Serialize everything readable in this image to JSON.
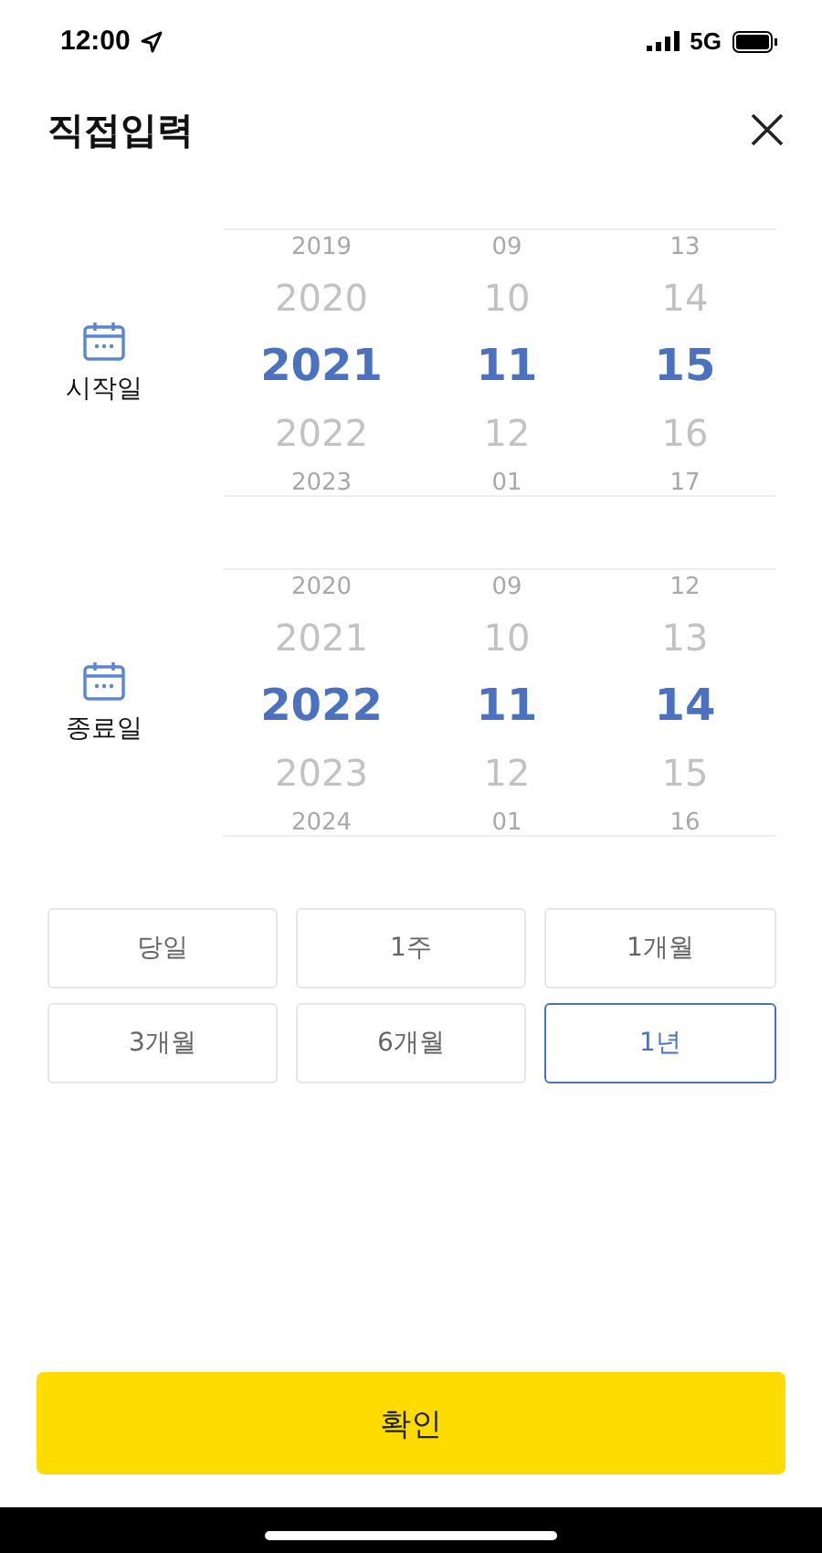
{
  "status_bar": {
    "time": "12:00",
    "network": "5G"
  },
  "header": {
    "title": "직접입력"
  },
  "pickers": [
    {
      "label": "시작일",
      "columns": [
        {
          "items": [
            {
              "text": "2019",
              "selected": false
            },
            {
              "text": "2020",
              "selected": false
            },
            {
              "text": "2021",
              "selected": true
            },
            {
              "text": "2022",
              "selected": false
            },
            {
              "text": "2023",
              "selected": false
            }
          ]
        },
        {
          "items": [
            {
              "text": "09",
              "selected": false
            },
            {
              "text": "10",
              "selected": false
            },
            {
              "text": "11",
              "selected": true
            },
            {
              "text": "12",
              "selected": false
            },
            {
              "text": "01",
              "selected": false
            }
          ]
        },
        {
          "items": [
            {
              "text": "13",
              "selected": false
            },
            {
              "text": "14",
              "selected": false
            },
            {
              "text": "15",
              "selected": true
            },
            {
              "text": "16",
              "selected": false
            },
            {
              "text": "17",
              "selected": false
            }
          ]
        }
      ]
    },
    {
      "label": "종료일",
      "columns": [
        {
          "items": [
            {
              "text": "2020",
              "selected": false
            },
            {
              "text": "2021",
              "selected": false
            },
            {
              "text": "2022",
              "selected": true
            },
            {
              "text": "2023",
              "selected": false
            },
            {
              "text": "2024",
              "selected": false
            }
          ]
        },
        {
          "items": [
            {
              "text": "09",
              "selected": false
            },
            {
              "text": "10",
              "selected": false
            },
            {
              "text": "11",
              "selected": true
            },
            {
              "text": "12",
              "selected": false
            },
            {
              "text": "01",
              "selected": false
            }
          ]
        },
        {
          "items": [
            {
              "text": "12",
              "selected": false
            },
            {
              "text": "13",
              "selected": false
            },
            {
              "text": "14",
              "selected": true
            },
            {
              "text": "15",
              "selected": false
            },
            {
              "text": "16",
              "selected": false
            }
          ]
        }
      ]
    }
  ],
  "presets": [
    {
      "label": "당일",
      "selected": false
    },
    {
      "label": "1주",
      "selected": false
    },
    {
      "label": "1개월",
      "selected": false
    },
    {
      "label": "3개월",
      "selected": false
    },
    {
      "label": "6개월",
      "selected": false
    },
    {
      "label": "1년",
      "selected": true
    }
  ],
  "confirm_button": "확인"
}
